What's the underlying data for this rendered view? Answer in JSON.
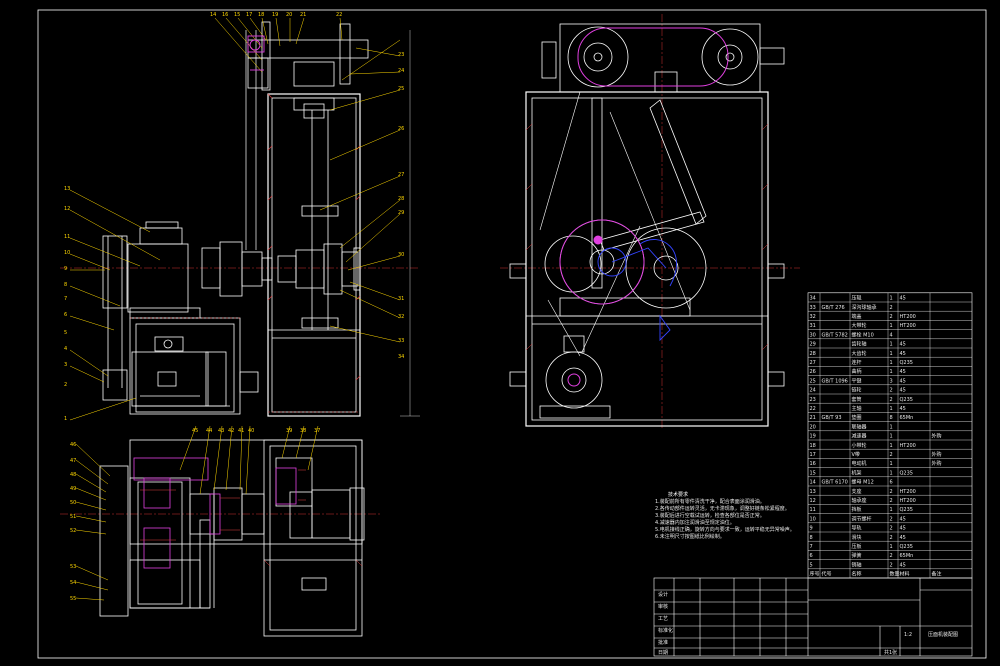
{
  "colors": {
    "background": "#000000",
    "outline": "#ffffff",
    "leader": "#ffd800",
    "hatch": "#e04040",
    "center": "#d03030",
    "mechanism": "#e040e0",
    "motion": "#3344ff",
    "parts": "#b0e0f0"
  },
  "notes": {
    "title": "技术要求",
    "lines": [
      "1.装配前所有零件清洗干净，配合表面涂润滑油。",
      "2.各传动部件运转灵活，无卡滞现象，调整好链条松紧程度。",
      "3.装配后进行空载试运转，检查各部位是否正常。",
      "4.减速器内加注润滑油至规定油位。",
      "5.电机接线正确，旋转方向与要求一致，运转平稳无异常噪声。",
      "6.未注明尺寸按图纸比例绘制。"
    ]
  },
  "title_block": {
    "drawing_title": "压面机装配图",
    "scale": "1:2",
    "sheet": "共1张",
    "material": "",
    "labels": [
      "设计",
      "审核",
      "工艺",
      "标准化",
      "批准",
      "日期"
    ]
  },
  "bom": {
    "headers": [
      "序号",
      "代号",
      "名称",
      "数量",
      "材料",
      "备注"
    ],
    "rows": [
      [
        "34",
        "",
        "压辊",
        "1",
        "45",
        ""
      ],
      [
        "33",
        "GB/T 276",
        "深沟球轴承",
        "2",
        "",
        ""
      ],
      [
        "32",
        "",
        "端盖",
        "2",
        "HT200",
        ""
      ],
      [
        "31",
        "",
        "大带轮",
        "1",
        "HT200",
        ""
      ],
      [
        "30",
        "GB/T 5782",
        "螺栓 M10",
        "4",
        "",
        ""
      ],
      [
        "29",
        "",
        "齿轮轴",
        "1",
        "45",
        ""
      ],
      [
        "28",
        "",
        "大齿轮",
        "1",
        "45",
        ""
      ],
      [
        "27",
        "",
        "连杆",
        "1",
        "Q235",
        ""
      ],
      [
        "26",
        "",
        "曲柄",
        "1",
        "45",
        ""
      ],
      [
        "25",
        "GB/T 1096",
        "平键",
        "3",
        "45",
        ""
      ],
      [
        "24",
        "",
        "链轮",
        "2",
        "45",
        ""
      ],
      [
        "23",
        "",
        "套筒",
        "2",
        "Q235",
        ""
      ],
      [
        "22",
        "",
        "主轴",
        "1",
        "45",
        ""
      ],
      [
        "21",
        "GB/T 93",
        "垫圈",
        "8",
        "65Mn",
        ""
      ],
      [
        "20",
        "",
        "联轴器",
        "1",
        "",
        ""
      ],
      [
        "19",
        "",
        "减速器",
        "1",
        "",
        "外购"
      ],
      [
        "18",
        "",
        "小带轮",
        "1",
        "HT200",
        ""
      ],
      [
        "17",
        "",
        "V带",
        "2",
        "",
        "外购"
      ],
      [
        "16",
        "",
        "电动机",
        "1",
        "",
        "外购"
      ],
      [
        "15",
        "",
        "机架",
        "1",
        "Q235",
        ""
      ],
      [
        "14",
        "GB/T 6170",
        "螺母 M12",
        "6",
        "",
        ""
      ],
      [
        "13",
        "",
        "支座",
        "2",
        "HT200",
        ""
      ],
      [
        "12",
        "",
        "轴承座",
        "2",
        "HT200",
        ""
      ],
      [
        "11",
        "",
        "挡板",
        "1",
        "Q235",
        ""
      ],
      [
        "10",
        "",
        "调节螺杆",
        "2",
        "45",
        ""
      ],
      [
        "9",
        "",
        "导轨",
        "2",
        "45",
        ""
      ],
      [
        "8",
        "",
        "滑块",
        "2",
        "45",
        ""
      ],
      [
        "7",
        "",
        "压板",
        "1",
        "Q235",
        ""
      ],
      [
        "6",
        "",
        "弹簧",
        "2",
        "65Mn",
        ""
      ],
      [
        "5",
        "",
        "销轴",
        "2",
        "45",
        ""
      ]
    ]
  },
  "callouts_front": [
    "14",
    "16",
    "15",
    "17",
    "18",
    "19",
    "20",
    "21",
    "22",
    "23",
    "24",
    "25",
    "26",
    "27",
    "28",
    "29",
    "30",
    "31",
    "32",
    "33",
    "34"
  ],
  "callouts_left": [
    "13",
    "12",
    "11",
    "10",
    "9",
    "8",
    "7",
    "6",
    "5",
    "4",
    "3",
    "2",
    "1"
  ],
  "callouts_plan": [
    "45",
    "44",
    "43",
    "42",
    "41",
    "40",
    "39",
    "38",
    "37",
    "36",
    "35"
  ],
  "callouts_plan_left": [
    "46",
    "47",
    "48",
    "49",
    "50",
    "51",
    "52",
    "53",
    "54",
    "55"
  ]
}
